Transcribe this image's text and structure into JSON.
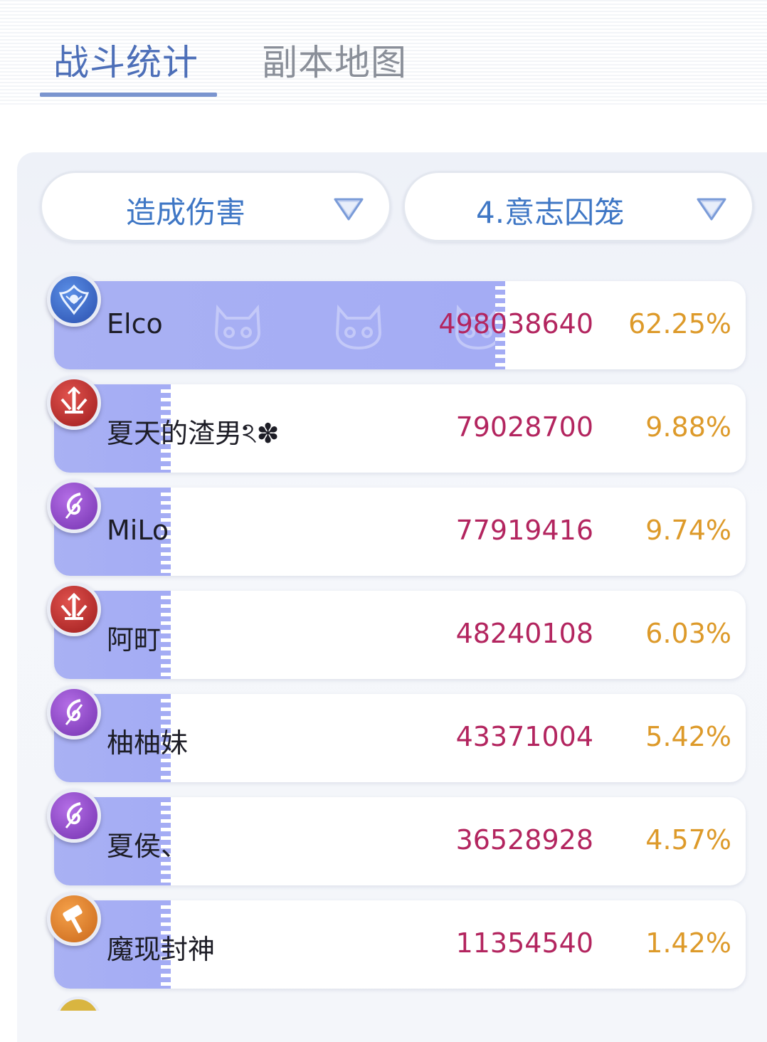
{
  "tabs": [
    {
      "label": "战斗统计",
      "active": true
    },
    {
      "label": "副本地图",
      "active": false
    }
  ],
  "filters": {
    "metric": "造成伤害",
    "dungeon": "4.意志囚笼"
  },
  "colors": {
    "accent": "#4d6fb8",
    "bar": "#a9b1f3",
    "value": "#b3255f",
    "percent": "#dd9a2a"
  },
  "rows": [
    {
      "name": "Elco",
      "value": "498038640",
      "percent": "62.25%",
      "share": 0.6225,
      "class_icon": "wing-emblem-icon",
      "badge": "blue"
    },
    {
      "name": "夏天的渣男ঽ✽",
      "value": "79028700",
      "percent": "9.88%",
      "share": 0.0988,
      "class_icon": "sword-emblem-icon",
      "badge": "red"
    },
    {
      "name": "MiLo",
      "value": "77919416",
      "percent": "9.74%",
      "share": 0.0974,
      "class_icon": "swirl-emblem-icon",
      "badge": "purple"
    },
    {
      "name": "阿町",
      "value": "48240108",
      "percent": "6.03%",
      "share": 0.0603,
      "class_icon": "sword-emblem-icon",
      "badge": "red"
    },
    {
      "name": "柚柚妹",
      "value": "43371004",
      "percent": "5.42%",
      "share": 0.0542,
      "class_icon": "swirl-emblem-icon",
      "badge": "purple"
    },
    {
      "name": "夏侯、",
      "value": "36528928",
      "percent": "4.57%",
      "share": 0.0457,
      "class_icon": "swirl-emblem-icon",
      "badge": "purple"
    },
    {
      "name": "魔现封神",
      "value": "11354540",
      "percent": "1.42%",
      "share": 0.0142,
      "class_icon": "hammer-emblem-icon",
      "badge": "orange"
    }
  ]
}
